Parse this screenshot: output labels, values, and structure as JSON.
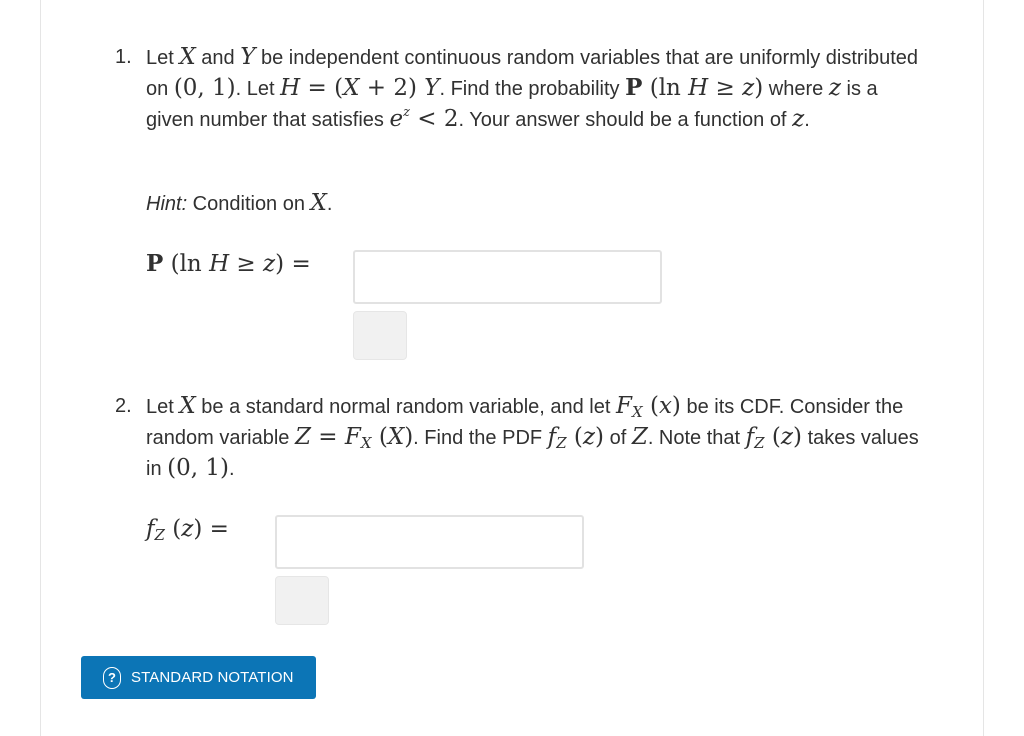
{
  "problems": [
    {
      "number": "1.",
      "text": {
        "t1": "Let ",
        "X": "X",
        "t2": " and ",
        "Y": "Y",
        "t3": " be independent continuous random variables that are uniformly distributed on ",
        "interval": "(0, 1)",
        "t4": ". Let ",
        "H_def_lhs": "H",
        "H_def_eq": " = (",
        "H_def_X": "X",
        "H_def_plus": " + 2) ",
        "H_def_Y": "Y",
        "t5": ". Find the probability ",
        "P": "P",
        "prob_open": " (ln ",
        "prob_H": "H",
        "prob_ge": " ≥ ",
        "prob_z": "z",
        "prob_close": ")",
        "t6": " where ",
        "z1": "z",
        "t7": " is a given number that satisfies ",
        "e": "e",
        "e_sup": "z",
        "lt2": " < 2",
        "t8": ". Your answer should be a function of ",
        "z2": "z",
        "t9": "."
      },
      "hint": {
        "label": "Hint:",
        "text": " Condition on ",
        "var": "X",
        "end": "."
      },
      "answer_label": {
        "P": "P",
        "open": " (ln ",
        "H": "H",
        "ge": " ≥ ",
        "z": "z",
        "close": ") ="
      },
      "answer_value": "",
      "answer_placeholder": ""
    },
    {
      "number": "2.",
      "text": {
        "t1": "Let ",
        "X": "X",
        "t2": " be a standard normal random variable, and let ",
        "F": "F",
        "F_sub": "X",
        "F_arg": " (",
        "x": "x",
        "F_close": ")",
        "t3": " be its CDF. Consider the random variable ",
        "Z": "Z",
        "eq": " = ",
        "F2": "F",
        "F2_sub": "X",
        "F2_open": " (",
        "X2": "X",
        "F2_close": ")",
        "t4": ". Find the PDF ",
        "f": "f",
        "f_sub": "Z",
        "f_open": " (",
        "fz": "z",
        "f_close": ")",
        "t5": " of ",
        "Z2": "Z",
        "t6": ". Note that ",
        "f2": "f",
        "f2_sub": "Z",
        "f2_open": " (",
        "f2z": "z",
        "f2_close": ")",
        "t7": " takes values in ",
        "interval": "(0, 1)",
        "t8": "."
      },
      "answer_label": {
        "f": "f",
        "sub": "Z",
        "open": " (",
        "z": "z",
        "close": ") ="
      },
      "answer_value": "",
      "answer_placeholder": ""
    }
  ],
  "notation_button": {
    "icon": "question-circle-icon",
    "label": "STANDARD NOTATION",
    "color": "#0c75b6"
  }
}
